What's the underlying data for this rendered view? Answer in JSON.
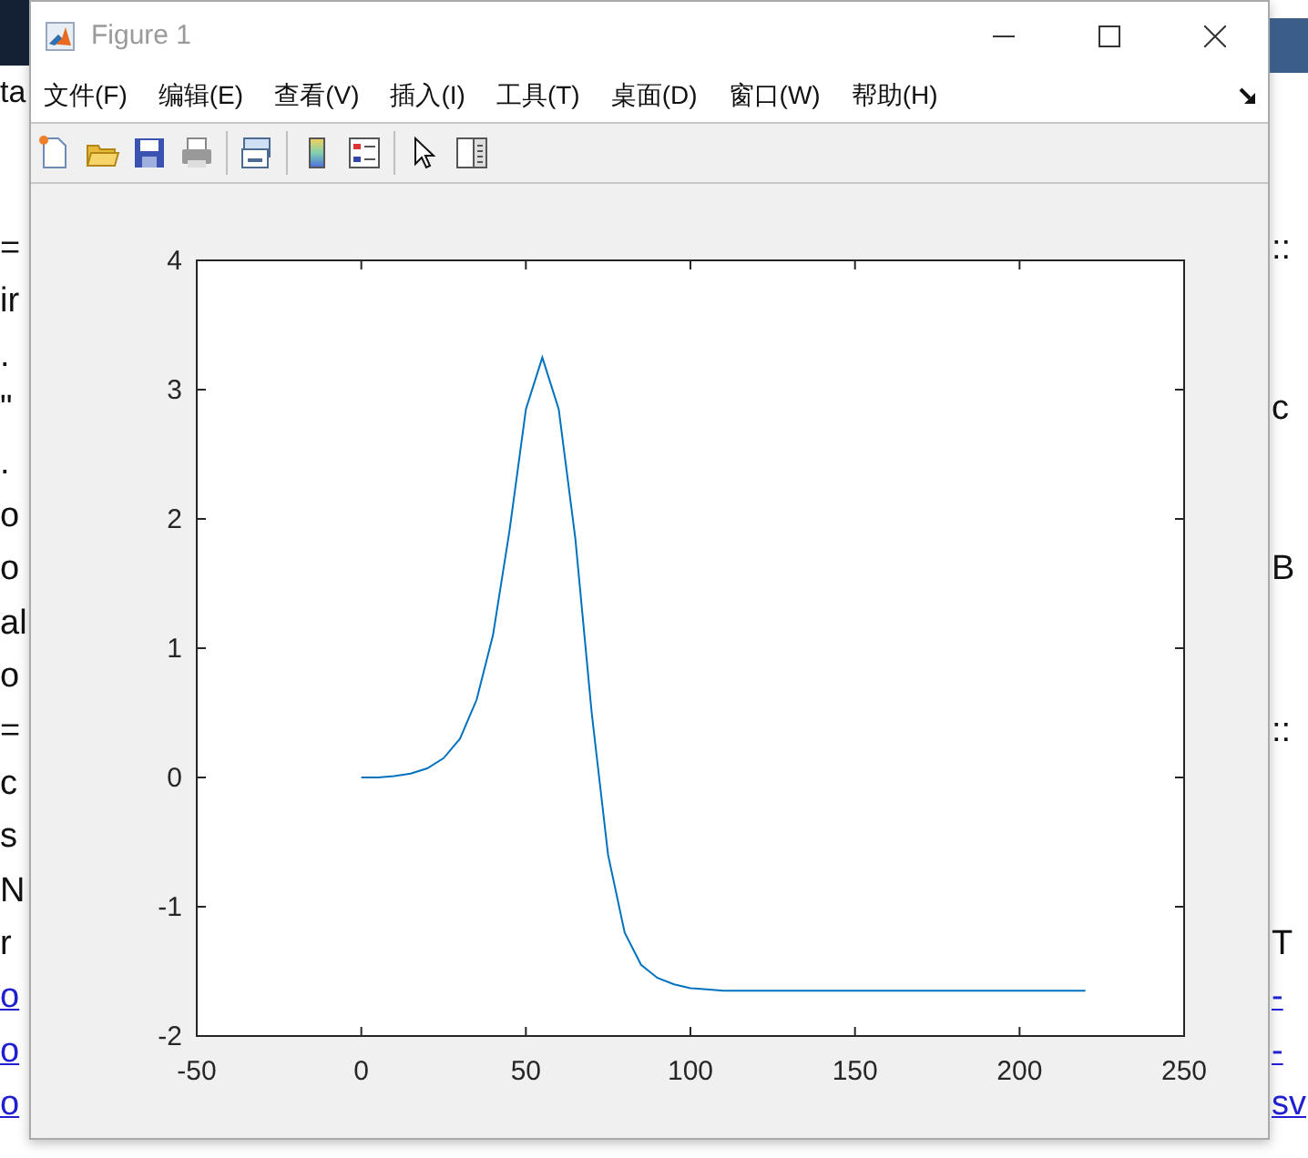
{
  "background": {
    "top_fragment": "ta",
    "left_fragments": [
      {
        "text": "=",
        "kind": "text"
      },
      {
        "text": "ir",
        "kind": "text"
      },
      {
        "text": ".",
        "kind": "text"
      },
      {
        "text": "\"",
        "kind": "text"
      },
      {
        "text": ".",
        "kind": "text"
      },
      {
        "text": "o",
        "kind": "text"
      },
      {
        "text": "o",
        "kind": "text"
      },
      {
        "text": "al",
        "kind": "text"
      },
      {
        "text": "o",
        "kind": "text"
      },
      {
        "text": "=",
        "kind": "text"
      },
      {
        "text": "c",
        "kind": "text"
      },
      {
        "text": "s",
        "kind": "text"
      },
      {
        "text": "N",
        "kind": "text"
      },
      {
        "text": "r",
        "kind": "text"
      },
      {
        "text": "o",
        "kind": "link"
      },
      {
        "text": "o",
        "kind": "link"
      },
      {
        "text": "o",
        "kind": "link"
      }
    ],
    "right_fragments": [
      {
        "text": "::",
        "kind": "text"
      },
      {
        "text": "c",
        "kind": "text"
      },
      {
        "text": "B",
        "kind": "text"
      },
      {
        "text": "::",
        "kind": "text"
      },
      {
        "text": "T",
        "kind": "text"
      },
      {
        "text": "-",
        "kind": "link"
      },
      {
        "text": "-",
        "kind": "link"
      },
      {
        "text": "sv",
        "kind": "link"
      }
    ]
  },
  "window": {
    "title": "Figure 1",
    "menus": [
      "文件(F)",
      "编辑(E)",
      "查看(V)",
      "插入(I)",
      "工具(T)",
      "桌面(D)",
      "窗口(W)",
      "帮助(H)"
    ]
  },
  "figure": {
    "chart_data": {
      "type": "line",
      "xlim": [
        -50,
        250
      ],
      "ylim": [
        -2,
        4
      ],
      "xticks": [
        -50,
        0,
        50,
        100,
        150,
        200,
        250
      ],
      "yticks": [
        -2,
        -1,
        0,
        1,
        2,
        3,
        4
      ],
      "x": [
        0,
        5,
        10,
        15,
        20,
        25,
        30,
        35,
        40,
        45,
        50,
        55,
        60,
        65,
        70,
        75,
        80,
        85,
        90,
        95,
        100,
        105,
        110,
        120,
        130,
        140,
        150,
        160,
        170,
        180,
        190,
        200,
        210,
        220
      ],
      "series": [
        {
          "color": "#0072bd",
          "values": [
            0,
            0,
            0.01,
            0.03,
            0.07,
            0.15,
            0.3,
            0.6,
            1.1,
            1.9,
            2.85,
            3.25,
            2.85,
            1.85,
            0.5,
            -0.6,
            -1.2,
            -1.45,
            -1.55,
            -1.6,
            -1.63,
            -1.64,
            -1.65,
            -1.65,
            -1.65,
            -1.65,
            -1.65,
            -1.65,
            -1.65,
            -1.65,
            -1.65,
            -1.65,
            -1.65,
            -1.65
          ]
        }
      ]
    }
  }
}
